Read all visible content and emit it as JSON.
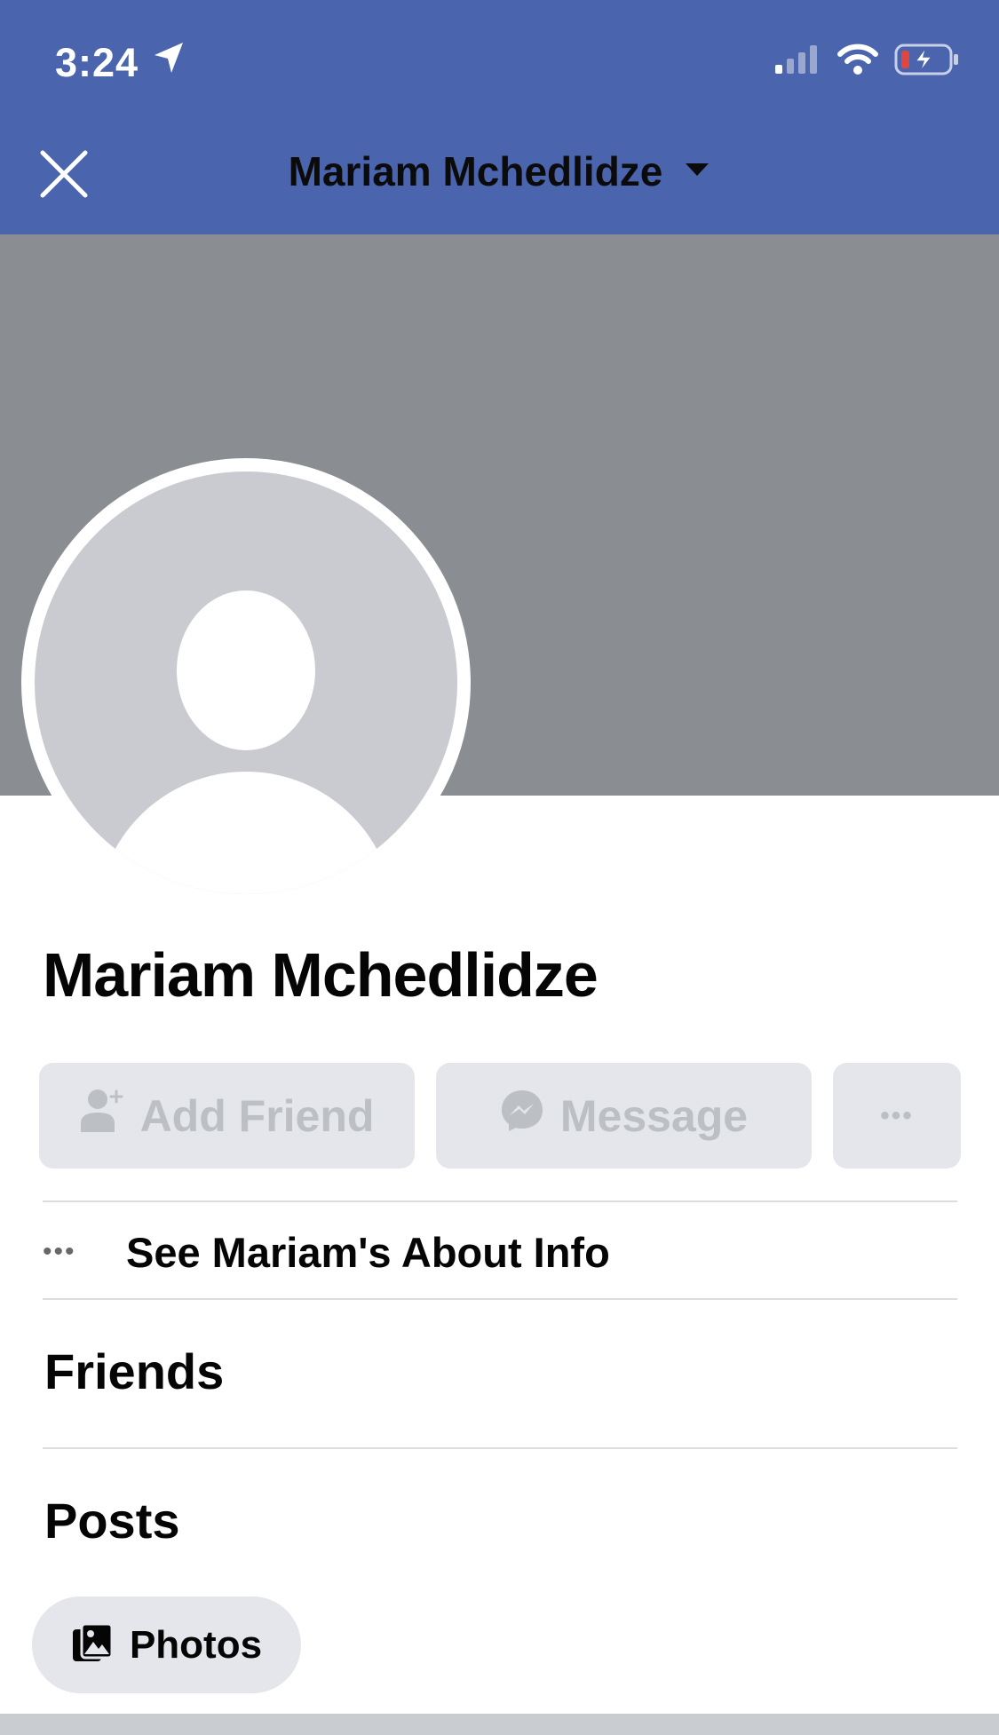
{
  "status_bar": {
    "time": "3:24",
    "icons": [
      "location-arrow-icon",
      "cellular-signal-icon",
      "wifi-icon",
      "battery-charging-icon"
    ]
  },
  "header": {
    "title": "Mariam Mchedlidze",
    "icons": [
      "close-icon",
      "caret-down-icon"
    ]
  },
  "profile": {
    "name": "Mariam Mchedlidze",
    "avatar_icon": "default-avatar-icon"
  },
  "actions": {
    "add_friend_label": "Add Friend",
    "message_label": "Message",
    "more_label": "•••"
  },
  "about": {
    "label": "See Mariam's About Info",
    "icon_text": "•••"
  },
  "sections": {
    "friends_title": "Friends",
    "posts_title": "Posts"
  },
  "photos": {
    "label": "Photos"
  },
  "colors": {
    "header_bg": "#4a65ad",
    "cover_bg": "#8a8d91",
    "button_bg": "#e4e6eb",
    "disabled_text": "#bcc0c4",
    "battery_low": "#e0463e"
  }
}
